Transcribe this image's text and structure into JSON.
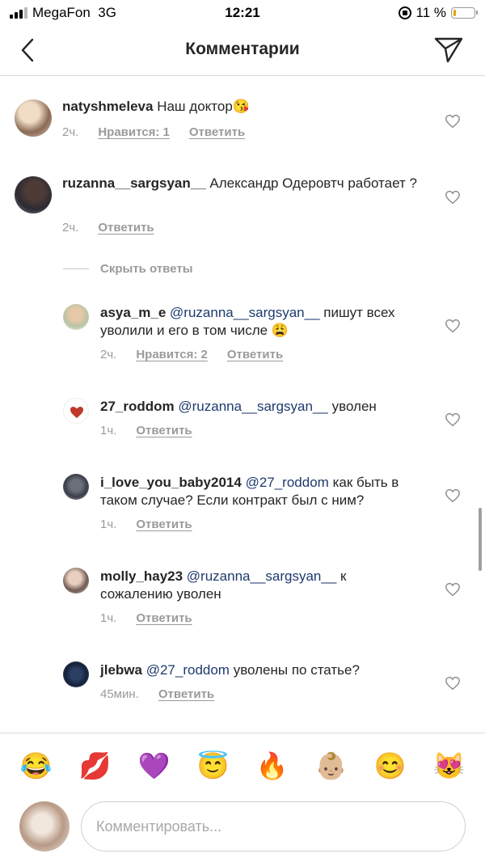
{
  "status_bar": {
    "carrier": "MegaFon",
    "network": "3G",
    "time": "12:21",
    "battery": "11 %"
  },
  "header": {
    "title": "Комментарии",
    "back_icon": "chevron-left-icon",
    "send_icon": "paper-plane-icon"
  },
  "comments": [
    {
      "username": "natyshmeleva",
      "text": "Наш доктор😘",
      "time": "2ч.",
      "likes": "Нравится: 1",
      "reply": "Ответить"
    },
    {
      "username": "ruzanna__sargsyan__",
      "text": "Александр Одеровтч работает ?",
      "time": "2ч.",
      "reply": "Ответить"
    }
  ],
  "hide_replies": "Скрыть ответы",
  "replies": [
    {
      "username": "asya_m_e",
      "mention": "@ruzanna__sargsyan__",
      "text": "пишут всех уволили и его в том числе 😩",
      "time": "2ч.",
      "likes": "Нравится: 2",
      "reply": "Ответить"
    },
    {
      "username": "27_roddom",
      "mention": "@ruzanna__sargsyan__",
      "text": "уволен",
      "time": "1ч.",
      "reply": "Ответить"
    },
    {
      "username": "i_love_you_baby2014",
      "mention": "@27_roddom",
      "text": "как быть в таком случае? Если контракт был с ним?",
      "time": "1ч.",
      "reply": "Ответить"
    },
    {
      "username": "molly_hay23",
      "mention": "@ruzanna__sargsyan__",
      "text": "к сожалению уволен",
      "time": "1ч.",
      "reply": "Ответить"
    },
    {
      "username": "jlebwa",
      "mention": "@27_roddom",
      "text": "уволены по статье?",
      "time": "45мин.",
      "reply": "Ответить"
    }
  ],
  "emoji_bar": [
    "😂",
    "💋",
    "💜",
    "😇",
    "🔥",
    "👶🏼",
    "😊",
    "😻"
  ],
  "input": {
    "placeholder": "Комментировать..."
  },
  "colors": {
    "mention": "#1f3a6e",
    "meta": "#9a9a9a",
    "divider": "#dbdbdb"
  }
}
